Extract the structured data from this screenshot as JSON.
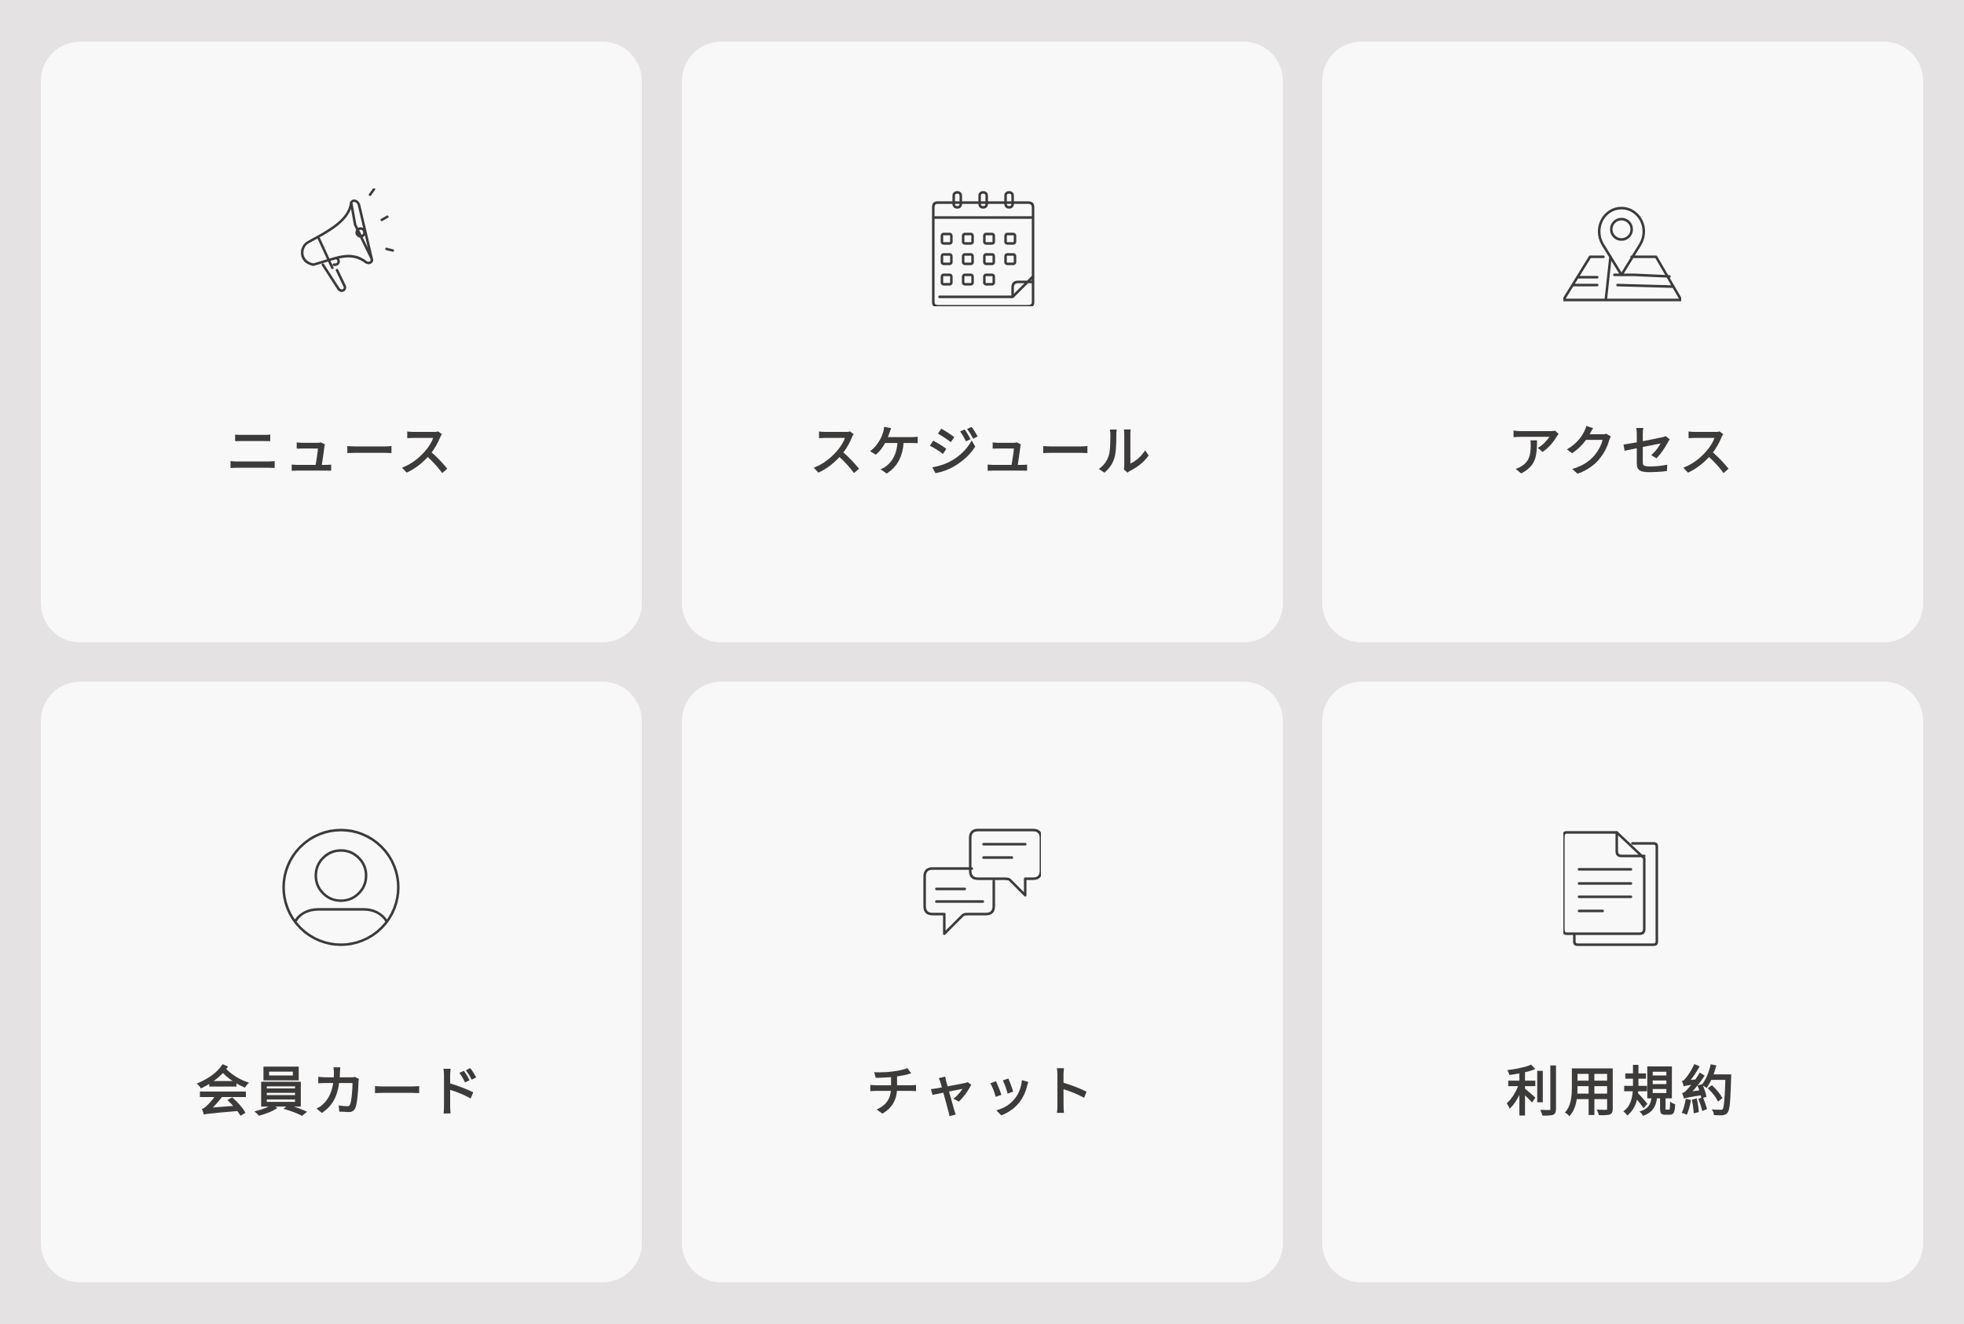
{
  "menu": {
    "items": [
      {
        "label": "ニュース",
        "icon": "megaphone-icon"
      },
      {
        "label": "スケジュール",
        "icon": "calendar-icon"
      },
      {
        "label": "アクセス",
        "icon": "map-pin-icon"
      },
      {
        "label": "会員カード",
        "icon": "user-circle-icon"
      },
      {
        "label": "チャット",
        "icon": "chat-bubbles-icon"
      },
      {
        "label": "利用規約",
        "icon": "document-icon"
      }
    ]
  },
  "colors": {
    "background": "#e4e2e2",
    "tile": "#f8f8f8",
    "text": "#3d3a3a"
  }
}
